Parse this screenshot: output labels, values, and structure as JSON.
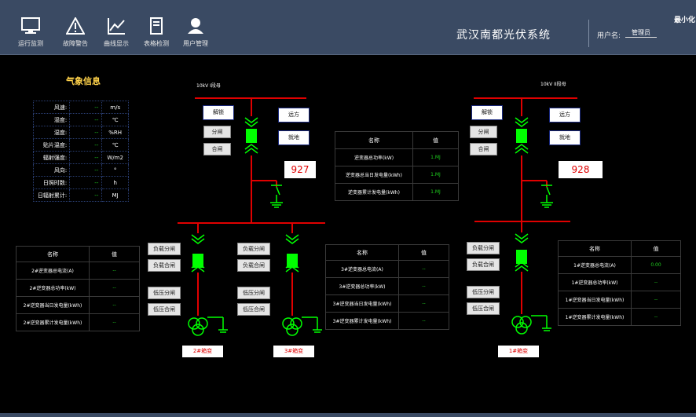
{
  "header": {
    "nav": [
      {
        "label": "运行监测",
        "icon": "monitor-icon"
      },
      {
        "label": "故障警告",
        "icon": "warning-icon"
      },
      {
        "label": "曲线显示",
        "icon": "chart-line-icon"
      },
      {
        "label": "表格检测",
        "icon": "table-doc-icon"
      },
      {
        "label": "用户管理",
        "icon": "user-icon"
      }
    ],
    "system_title": "武汉南都光伏系统",
    "user_label": "用户名:",
    "user_name": "管理员",
    "minimize_label": "最小化"
  },
  "weather": {
    "title": "气象信息",
    "rows": [
      {
        "label": "风速:",
        "value": "--",
        "unit": "m/s"
      },
      {
        "label": "湿度:",
        "value": "--",
        "unit": "℃"
      },
      {
        "label": "湿度:",
        "value": "--",
        "unit": "%RH"
      },
      {
        "label": "贴片温度:",
        "value": "--",
        "unit": "℃"
      },
      {
        "label": "辐射强度:",
        "value": "--",
        "unit": "W/m2"
      },
      {
        "label": "风向:",
        "value": "--",
        "unit": "°"
      },
      {
        "label": "日照时数:",
        "value": "--",
        "unit": "h"
      },
      {
        "label": "日辐射累计:",
        "value": "--",
        "unit": "MJ"
      }
    ]
  },
  "busbars": {
    "left": "10kV I段母",
    "right": "10kV II段母"
  },
  "left_panel": {
    "unlock": "解锁",
    "open": "分闸",
    "close": "合闸",
    "remote": "远方",
    "local": "就地",
    "value": "927"
  },
  "right_panel": {
    "unlock": "解锁",
    "open": "分闸",
    "close": "合闸",
    "remote": "远方",
    "local": "就地",
    "value": "928"
  },
  "center_table": {
    "headers": [
      "名称",
      "值"
    ],
    "rows": [
      {
        "name": "逆变器总功率(kW)",
        "value": "1.MJ"
      },
      {
        "name": "逆变器总当日发电量(kWh)",
        "value": "1.MJ"
      },
      {
        "name": "逆变器累计发电量(kWh)",
        "value": "1.MJ"
      }
    ]
  },
  "inv2_table": {
    "headers": [
      "名称",
      "值"
    ],
    "rows": [
      {
        "name": "2#逆变器总电流(A)",
        "value": "--"
      },
      {
        "name": "2#逆变器总功率(kW)",
        "value": "--"
      },
      {
        "name": "2#逆变器当日发电量(kWh)",
        "value": "--"
      },
      {
        "name": "2#逆变器累计发电量(kWh)",
        "value": "--"
      }
    ]
  },
  "inv3_table": {
    "headers": [
      "名称",
      "值"
    ],
    "rows": [
      {
        "name": "3#逆变器总电流(A)",
        "value": "--"
      },
      {
        "name": "3#逆变器总功率(kW)",
        "value": "--"
      },
      {
        "name": "3#逆变器当日发电量(kWh)",
        "value": "--"
      },
      {
        "name": "3#逆变器累计发电量(kWh)",
        "value": "--"
      }
    ]
  },
  "inv1_table": {
    "headers": [
      "名称",
      "值"
    ],
    "rows": [
      {
        "name": "1#逆变器总电流(A)",
        "value": "0.00"
      },
      {
        "name": "1#逆变器总功率(kW)",
        "value": "--"
      },
      {
        "name": "1#逆变器当日发电量(kWh)",
        "value": "--"
      },
      {
        "name": "1#逆变器累计发电量(kWh)",
        "value": "--"
      }
    ]
  },
  "feeder2": {
    "load_open": "负载分闸",
    "load_close": "负载合闸",
    "lv_open": "低压分闸",
    "lv_close": "低压合闸",
    "label": "2#箱变"
  },
  "feeder3": {
    "load_open": "负载分闸",
    "load_close": "负载合闸",
    "lv_open": "低压分闸",
    "lv_close": "低压合闸",
    "label": "3#箱变"
  },
  "feeder1": {
    "load_open": "负载分闸",
    "load_close": "负载合闸",
    "lv_open": "低压分闸",
    "lv_close": "低压合闸",
    "label": "1#箱变"
  },
  "colors": {
    "line": "#e00000",
    "breaker": "#00ff00",
    "accent": "#3a4a63",
    "value_green": "#1fd11f",
    "title_yellow": "#ffd24a"
  }
}
